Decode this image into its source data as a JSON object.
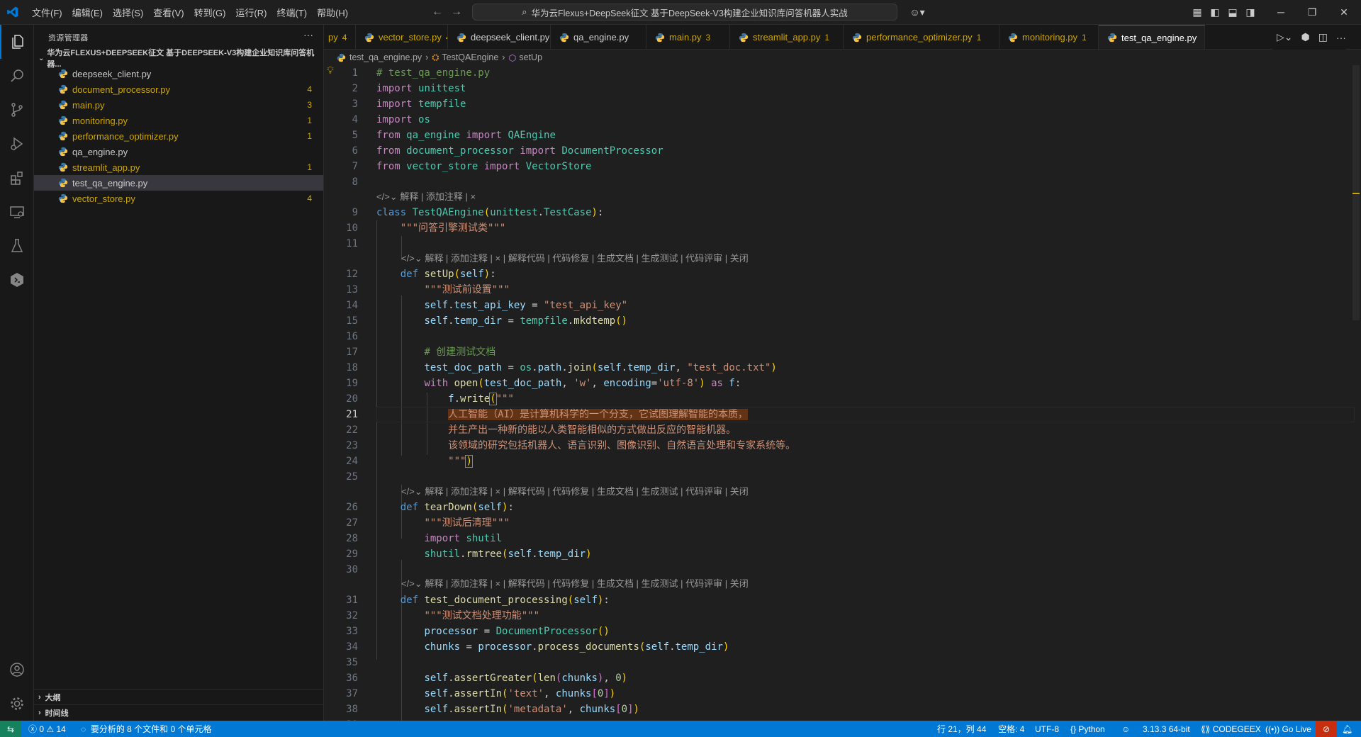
{
  "menu": [
    "文件(F)",
    "编辑(E)",
    "选择(S)",
    "查看(V)",
    "转到(G)",
    "运行(R)",
    "终端(T)",
    "帮助(H)"
  ],
  "command_center": "华为云Flexus+DeepSeek征文 基于DeepSeek-V3构建企业知识库问答机器人实战",
  "sidebar": {
    "title": "资源管理器",
    "folder": "华为云FLEXUS+DEEPSEEK征文 基于DEEPSEEK-V3构建企业知识库问答机器...",
    "files": [
      {
        "name": "deepseek_client.py",
        "badge": "",
        "color": "#cccccc"
      },
      {
        "name": "document_processor.py",
        "badge": "4",
        "color": "#cca700"
      },
      {
        "name": "main.py",
        "badge": "3",
        "color": "#cca700"
      },
      {
        "name": "monitoring.py",
        "badge": "1",
        "color": "#cca700"
      },
      {
        "name": "performance_optimizer.py",
        "badge": "1",
        "color": "#cca700"
      },
      {
        "name": "qa_engine.py",
        "badge": "",
        "color": "#cccccc"
      },
      {
        "name": "streamlit_app.py",
        "badge": "1",
        "color": "#cca700"
      },
      {
        "name": "test_qa_engine.py",
        "badge": "",
        "color": "#cccccc"
      },
      {
        "name": "vector_store.py",
        "badge": "4",
        "color": "#cca700"
      }
    ],
    "outline": "大纲",
    "timeline": "时间线"
  },
  "tabs": [
    {
      "name": "py",
      "badge": "4",
      "active": false
    },
    {
      "name": "vector_store.py",
      "badge": "4",
      "active": false
    },
    {
      "name": "deepseek_client.py",
      "badge": "",
      "active": false
    },
    {
      "name": "qa_engine.py",
      "badge": "",
      "active": false
    },
    {
      "name": "main.py",
      "badge": "3",
      "active": false
    },
    {
      "name": "streamlit_app.py",
      "badge": "1",
      "active": false
    },
    {
      "name": "performance_optimizer.py",
      "badge": "1",
      "active": false
    },
    {
      "name": "monitoring.py",
      "badge": "1",
      "active": false
    },
    {
      "name": "test_qa_engine.py",
      "badge": "",
      "active": true
    }
  ],
  "breadcrumb": [
    "test_qa_engine.py",
    "TestQAEngine",
    "setUp"
  ],
  "codelens_short": "解释 | 添加注释 | ×",
  "codelens_long": "解释 | 添加注释 | × | 解释代码 | 代码修复 | 生成文档 | 生成测试 | 代码评审 | 关闭",
  "status": {
    "errors": "0",
    "warnings": "14",
    "analysis": "要分析的 8 个文件和 0 个单元格",
    "position": "行 21，列 44",
    "spaces": "空格: 4",
    "encoding": "UTF-8",
    "language": "Python",
    "interpreter": "3.13.3 64-bit",
    "codegeex": "CODEGEEX",
    "golive": "Go Live"
  },
  "colors": {
    "accent": "#0078d4",
    "warning_badge": "#cca700"
  }
}
